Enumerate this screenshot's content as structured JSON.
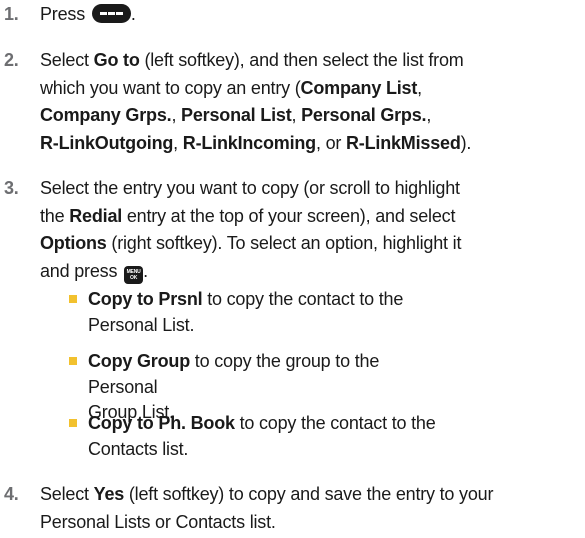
{
  "steps": [
    {
      "number": "1.",
      "lines": [
        {
          "t1": "Press "
        }
      ],
      "end": "."
    },
    {
      "number": "2.",
      "l1": "Select ",
      "l1b": "Go to",
      "l1c": " (left softkey), and then select the list from",
      "l2": "which you want to copy an entry (",
      "l2b": "Company List",
      "l2c": ",",
      "l3b1": "Company Grps.",
      "l3c1": ", ",
      "l3b2": "Personal List",
      "l3c2": ", ",
      "l3b3": "Personal Grps.",
      "l3c3": ",",
      "l4b1": "R-LinkOutgoing",
      "l4c1": ", ",
      "l4b2": "R-LinkIncoming",
      "l4c2": ", or ",
      "l4b3": "R-LinkMissed",
      "l4c3": ")."
    },
    {
      "number": "3.",
      "l1": "Select the entry you want to copy (or scroll to highlight",
      "l2a": "the ",
      "l2b": "Redial",
      "l2c": " entry at the top of your screen), and select",
      "l3b": "Options",
      "l3c": " (right softkey). To select an option, highlight it",
      "l4a": "and press ",
      "l4c": "."
    },
    {
      "number": "4.",
      "l1a": "Select ",
      "l1b": "Yes",
      "l1c": " (left softkey) to copy and save the entry to your",
      "l2": "Personal Lists or Contacts list."
    }
  ],
  "step1_text": "Press ",
  "step1_end": ".",
  "menu_key_top": "MENU",
  "menu_key_bottom": "OK",
  "bullets": [
    {
      "bold": "Copy to Prsnl",
      "text1": " to copy the contact to the",
      "text2": "Personal List."
    },
    {
      "bold": "Copy Group",
      "text1": " to copy the group to the Personal",
      "text2": "Group List."
    },
    {
      "bold": "Copy to Ph. Book",
      "text1": " to copy the contact to the",
      "text2": "Contacts list."
    }
  ],
  "colors": {
    "step_number": "#6d6e71",
    "bullet": "#f2c12e",
    "text": "#1a1a1a"
  },
  "icons": [
    "talk-key-icon",
    "menu-ok-key-icon"
  ]
}
